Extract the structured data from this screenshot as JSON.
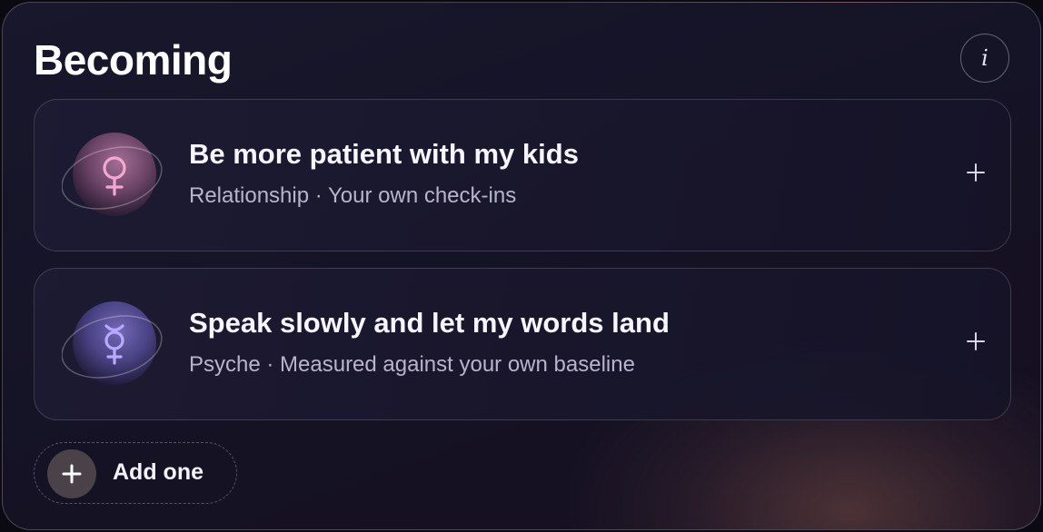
{
  "header": {
    "title": "Becoming",
    "info_label": "i"
  },
  "goals": [
    {
      "title": "Be more patient with my kids",
      "subtitle": "Relationship · Your own check-ins",
      "symbol": "venus-symbol",
      "orb_color": "#b0799f",
      "symbol_color": "#f3a9cf"
    },
    {
      "title": "Speak slowly and let my words land",
      "subtitle": "Psyche · Measured against your own baseline",
      "symbol": "mercury-symbol",
      "orb_color": "#6d62b0",
      "symbol_color": "#b9a8ff"
    }
  ],
  "add_button": {
    "label": "Add one"
  },
  "colors": {
    "panel_bg": "#17152a",
    "text_primary": "#f7f5ff",
    "text_secondary": "#b8b4cc"
  }
}
